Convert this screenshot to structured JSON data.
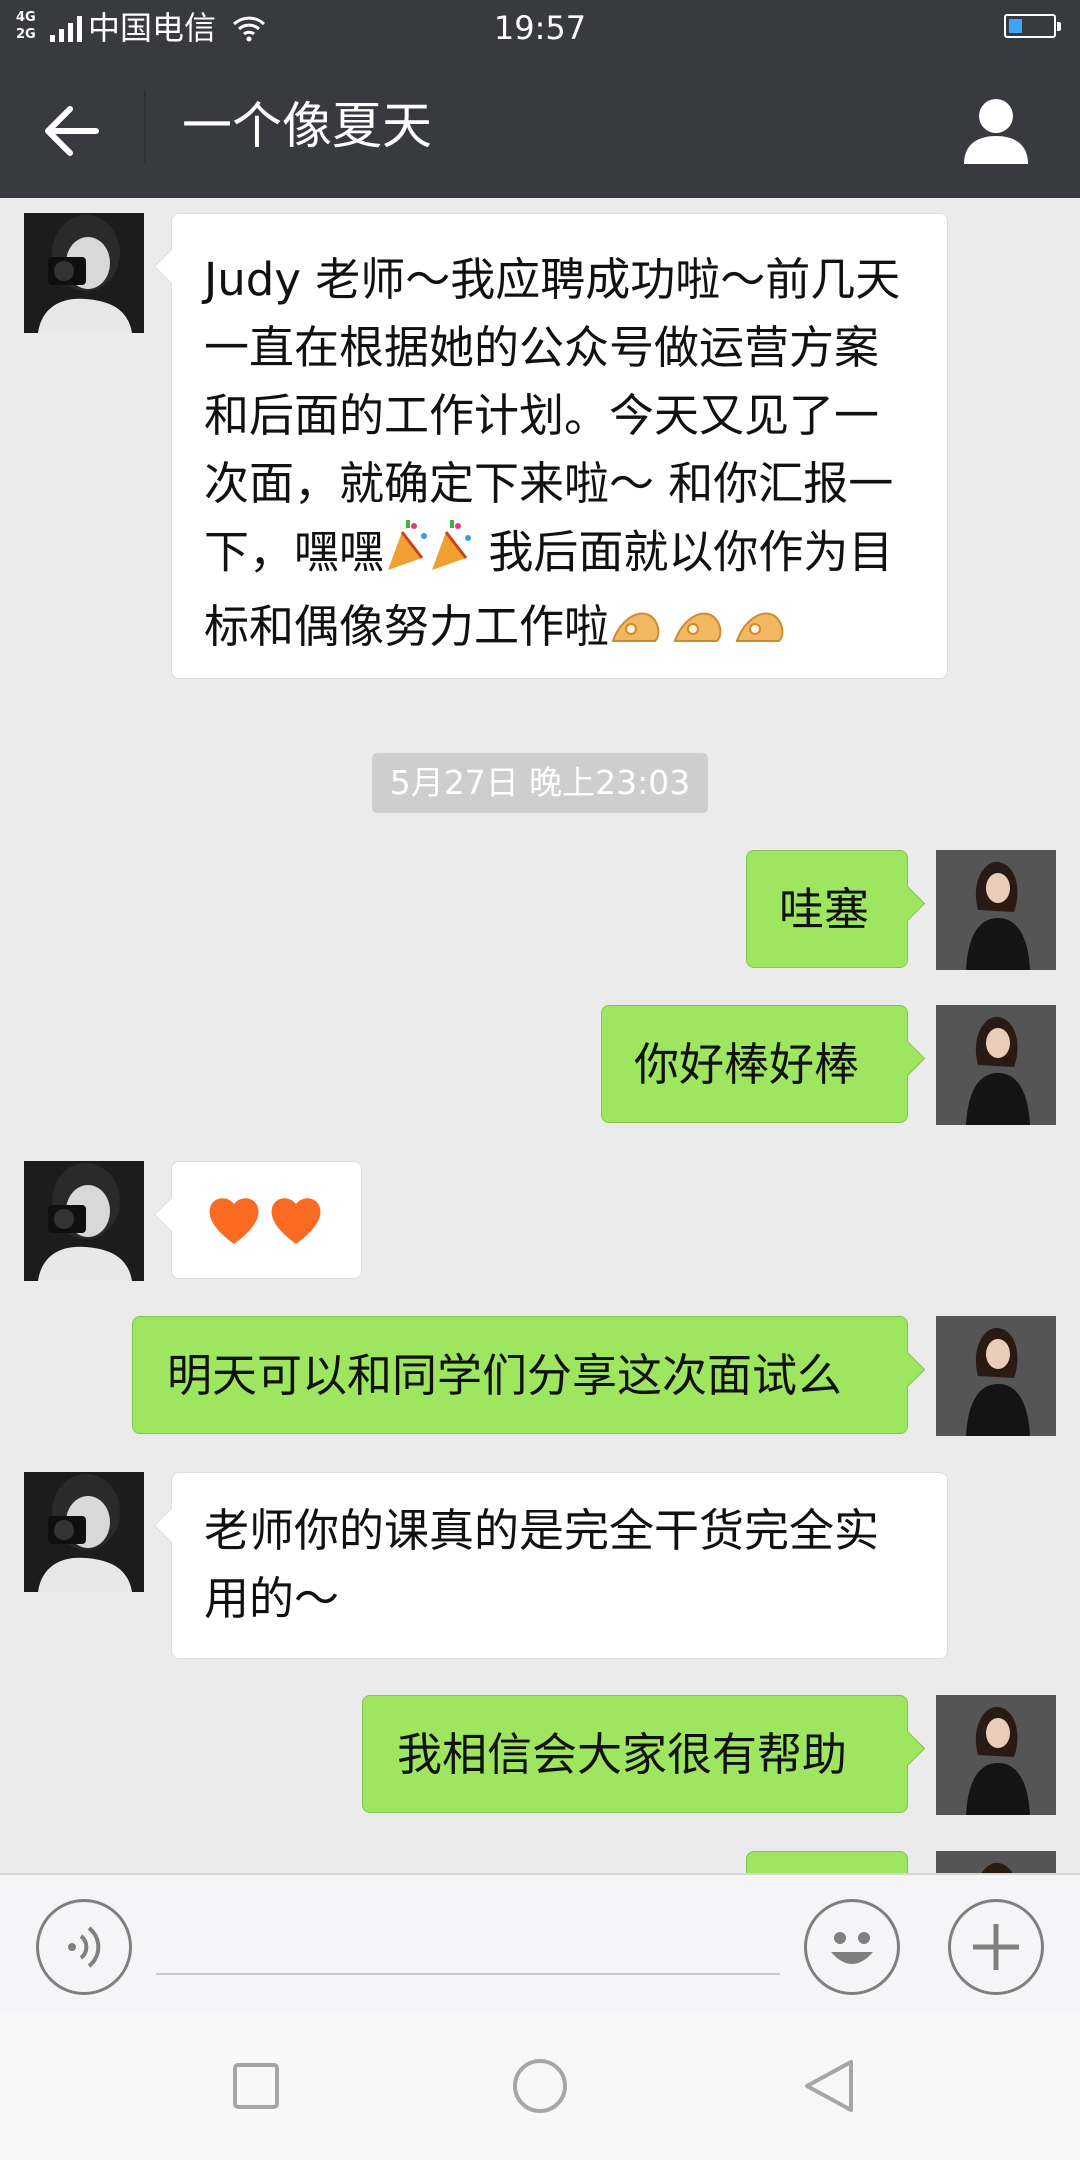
{
  "status_bar": {
    "net_type_top": "4G",
    "net_type_bottom": "2G",
    "carrier": "中国电信",
    "time": "19:57",
    "battery_fraction": 0.3,
    "battery_color": "#3aa7f5"
  },
  "header": {
    "title": "一个像夏天",
    "back_icon": "back-arrow-icon",
    "profile_icon": "person-icon"
  },
  "messages": [
    {
      "side": "in",
      "text": "Judy 老师～我应聘成功啦～前几天一直在根据她的公众号做运营方案和后面的工作计划。今天又见了一次面，就确定下来啦～ 和你汇报一下，嘿嘿",
      "text_after_emoji": " 我后面就以你作为目标和偶像努力工作啦",
      "emoji": [
        "party-popper",
        "party-popper"
      ],
      "emoji_end": [
        "ok-hand",
        "ok-hand",
        "ok-hand"
      ]
    },
    {
      "side": "out",
      "text": "哇塞"
    },
    {
      "side": "out",
      "text": "你好棒好棒"
    },
    {
      "side": "in",
      "emoji": [
        "orange-heart",
        "orange-heart"
      ]
    },
    {
      "side": "out",
      "text": "明天可以和同学们分享这次面试么"
    },
    {
      "side": "in",
      "text": "老师你的课真的是完全干货完全实用的～"
    },
    {
      "side": "out",
      "text": "我相信会大家很有帮助"
    }
  ],
  "timestamp": "5月27日 晚上23:03",
  "input_bar": {
    "voice_icon": "voice-icon",
    "emoji_icon": "smiley-icon",
    "plus_icon": "plus-icon",
    "placeholder": ""
  },
  "nav_bar": {
    "recent_icon": "square-icon",
    "home_icon": "circle-icon",
    "back_icon": "triangle-back-icon"
  },
  "colors": {
    "header_bg": "#393a3f",
    "chat_bg": "#ebebeb",
    "outgoing_bubble": "#9ee560",
    "incoming_bubble": "#ffffff",
    "timestamp_bg": "#cecece"
  }
}
